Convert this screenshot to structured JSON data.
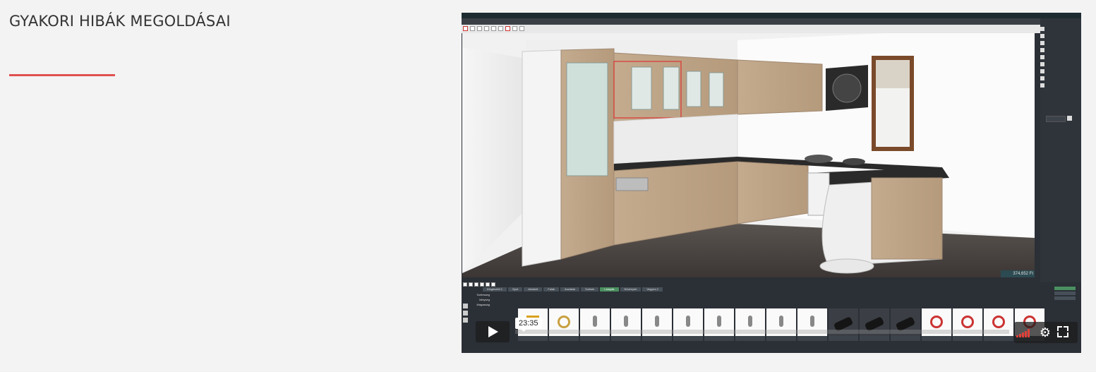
{
  "section": {
    "title": "GYAKORI HIBÁK MEGOLDÁSAI",
    "accent_color": "#e05050"
  },
  "video": {
    "duration_label": "23:35",
    "progress_fraction": 0.0,
    "controls": {
      "play_icon": "play-icon",
      "volume_icon": "volume-icon",
      "settings_icon": "gear-icon",
      "fullscreen_icon": "fullscreen-icon"
    },
    "app_screen": {
      "price": "374,652 Ft",
      "bottom_tabs": [
        "Kiegészítő 1",
        "Spot",
        "Alsóbeli",
        "Falak",
        "Asztalok",
        "Székek",
        "Lámpák",
        "Növények",
        "Vegyes 2"
      ],
      "active_tab_index": 6,
      "panel_labels": [
        "Szélesség",
        "Mélység",
        "Magasság"
      ]
    }
  }
}
